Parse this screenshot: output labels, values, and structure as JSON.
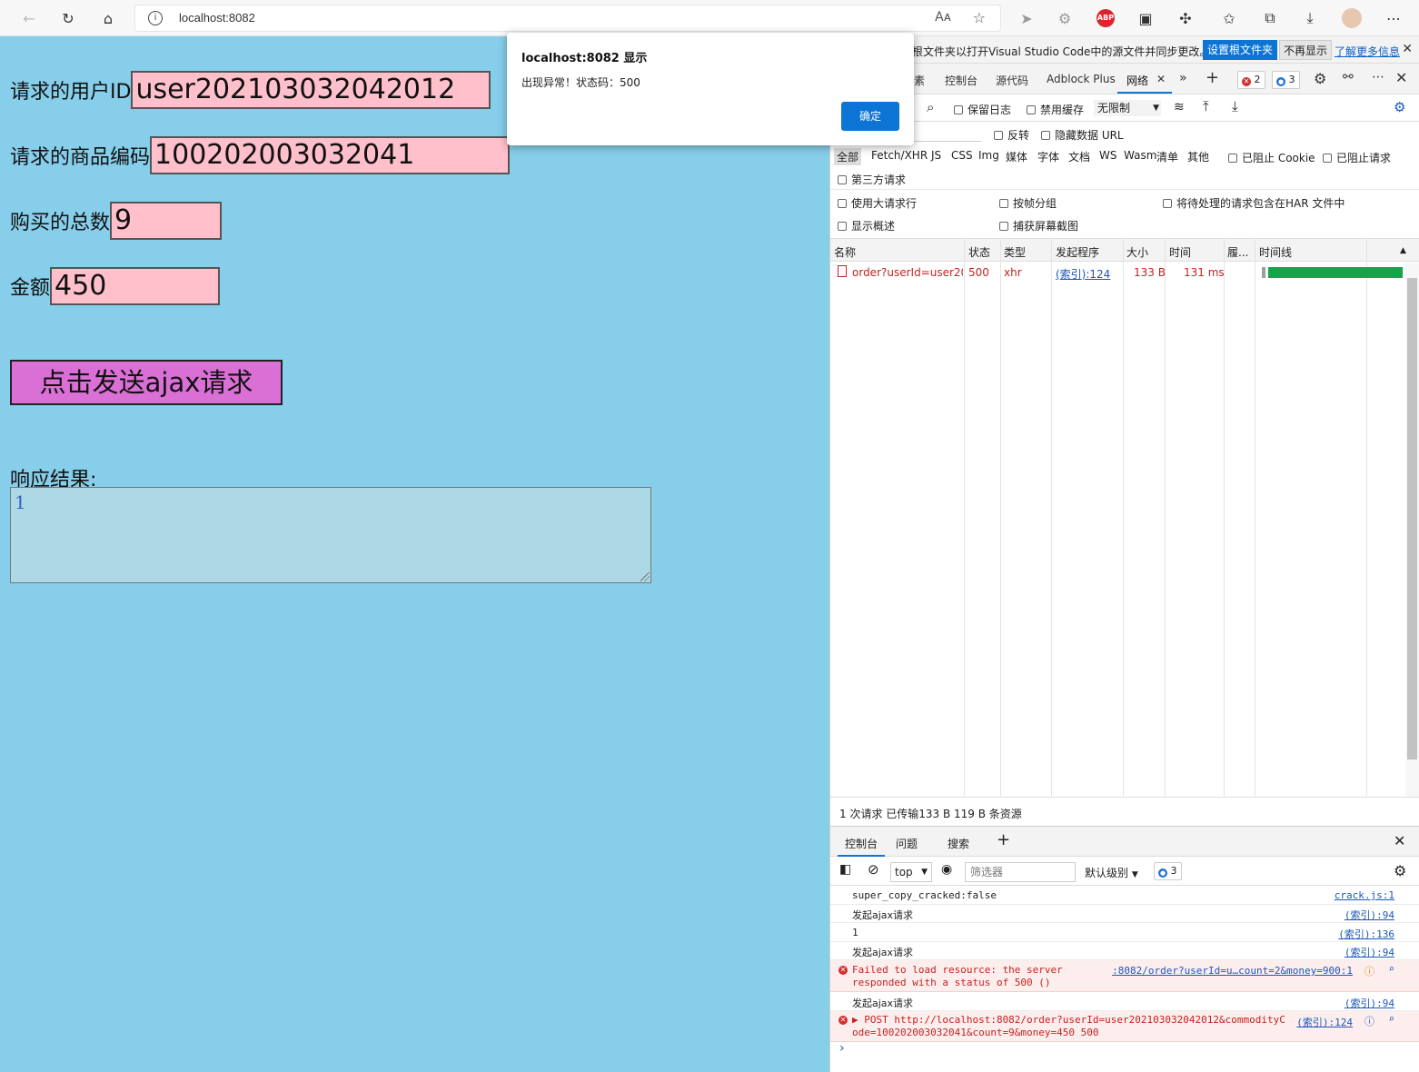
{
  "browser": {
    "url": "localhost:8082",
    "read_aloud_label": "Aᴀ",
    "abp_label": "ABP"
  },
  "form": {
    "user_id_label": "请求的用户ID",
    "user_id_value": "user202103032042012",
    "commodity_label": "请求的商品编码",
    "commodity_value": "100202003032041",
    "count_label": "购买的总数",
    "count_value": "9",
    "money_label": "金额",
    "money_value": "450",
    "send_button": "点击发送ajax请求",
    "response_label": "响应结果:",
    "response_value": "1"
  },
  "alert": {
    "title": "localhost:8082 显示",
    "message": "出现异常！状态码：500",
    "ok": "确定"
  },
  "devtools": {
    "infobar": {
      "message": "根文件夹以打开Visual Studio Code中的源文件并同步更改。",
      "set_root": "设置根文件夹",
      "dont_show": "不再显示",
      "learn_more": "了解更多信息"
    },
    "tabs": [
      "素",
      "控制台",
      "源代码",
      "Adblock Plus",
      "网络"
    ],
    "error_count": "2",
    "message_count": "3",
    "network": {
      "preserve_log": "保留日志",
      "disable_cache": "禁用缓存",
      "throttle": "无限制",
      "invert": "反转",
      "hide_data_url": "隐藏数据 URL",
      "types": [
        "全部",
        "Fetch/XHR",
        "JS",
        "CSS",
        "Img",
        "媒体",
        "字体",
        "文档",
        "WS",
        "Wasm",
        "清单",
        "其他"
      ],
      "blocked_cookies": "已阻止 Cookie",
      "blocked_requests": "已阻止请求",
      "third_party": "第三方请求",
      "large_rows": "使用大请求行",
      "group_by_frame": "按帧分组",
      "har_pending": "将待处理的请求包含在HAR 文件中",
      "show_overview": "显示概述",
      "capture_screenshots": "捕获屏幕截图",
      "columns": [
        "名称",
        "状态",
        "类型",
        "发起程序",
        "大小",
        "时间",
        "履...",
        "时间线"
      ],
      "rows": [
        {
          "name": "order?userId=user20...",
          "status": "500",
          "type": "xhr",
          "initiator": "(索引):124",
          "size": "133 B",
          "time": "131 ms"
        }
      ],
      "summary": "1 次请求  已传输133 B  119 B 条资源"
    },
    "drawer": {
      "tabs": [
        "控制台",
        "问题",
        "搜索"
      ],
      "context": "top",
      "filter_placeholder": "筛选器",
      "level": "默认级别",
      "msg_count": "3"
    },
    "console": [
      {
        "text": "super_copy_cracked:false",
        "source": "crack.js:1",
        "level": "log"
      },
      {
        "text": "发起ajax请求",
        "source": "(索引):94",
        "level": "log"
      },
      {
        "text": "1",
        "source": "(索引):136",
        "level": "log"
      },
      {
        "text": "发起ajax请求",
        "source": "(索引):94",
        "level": "log"
      },
      {
        "text": "Failed to load resource: the server\nresponded with a status of 500 ()",
        "source": ":8082/order?userId=u…count=2&money=900:1",
        "level": "error"
      },
      {
        "text": "发起ajax请求",
        "source": "(索引):94",
        "level": "log"
      },
      {
        "text": "▶ POST http://localhost:8082/order?userId=user202103032042012&commodityC\node=100202003032041&count=9&money=450 500",
        "source": "(索引):124",
        "level": "error"
      }
    ],
    "prompt": "›"
  },
  "colors": {
    "page_bg": "#87ceeb",
    "input_bg": "#ffc0cb",
    "button_bg": "#da70d6",
    "textarea_bg": "#add8e6",
    "accent": "#0c74d4",
    "error": "#c5221f",
    "timeline": "#17a34a"
  }
}
